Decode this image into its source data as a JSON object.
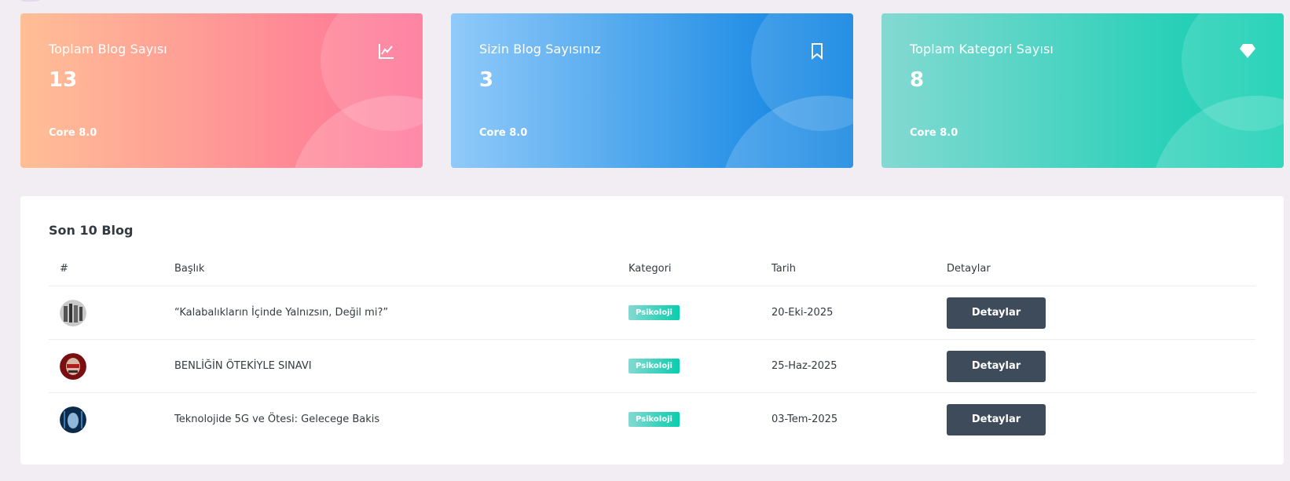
{
  "stats": [
    {
      "title": "Toplam Blog Sayısı",
      "value": "13",
      "footer": "Core 8.0",
      "icon": "chart-line-icon"
    },
    {
      "title": "Sizin Blog Sayısınız",
      "value": "3",
      "footer": "Core 8.0",
      "icon": "bookmark-icon"
    },
    {
      "title": "Toplam Kategori Sayısı",
      "value": "8",
      "footer": "Core 8.0",
      "icon": "diamond-icon"
    }
  ],
  "recent": {
    "title": "Son 10 Blog",
    "columns": [
      "#",
      "Başlık",
      "Kategori",
      "Tarih",
      "Detaylar"
    ],
    "rows": [
      {
        "title": "“Kalabalıkların İçinde Yalnızsın, Değil mi?”",
        "category": "Psikoloji",
        "date": "20-Eki-2025",
        "action": "Detaylar"
      },
      {
        "title": "BENLİĞİN ÖTEKİYLE SINAVI",
        "category": "Psikoloji",
        "date": "25-Haz-2025",
        "action": "Detaylar"
      },
      {
        "title": "Teknolojide 5G ve Ötesi: Gelecege Bakis",
        "category": "Psikoloji",
        "date": "03-Tem-2025",
        "action": "Detaylar"
      }
    ]
  },
  "colors": {
    "card1": [
      "#ffbf96",
      "#fe7096"
    ],
    "card2": [
      "#90caf9",
      "#047edf"
    ],
    "card3": [
      "#84d9d2",
      "#07cdae"
    ],
    "button": "#3e4b5b"
  }
}
